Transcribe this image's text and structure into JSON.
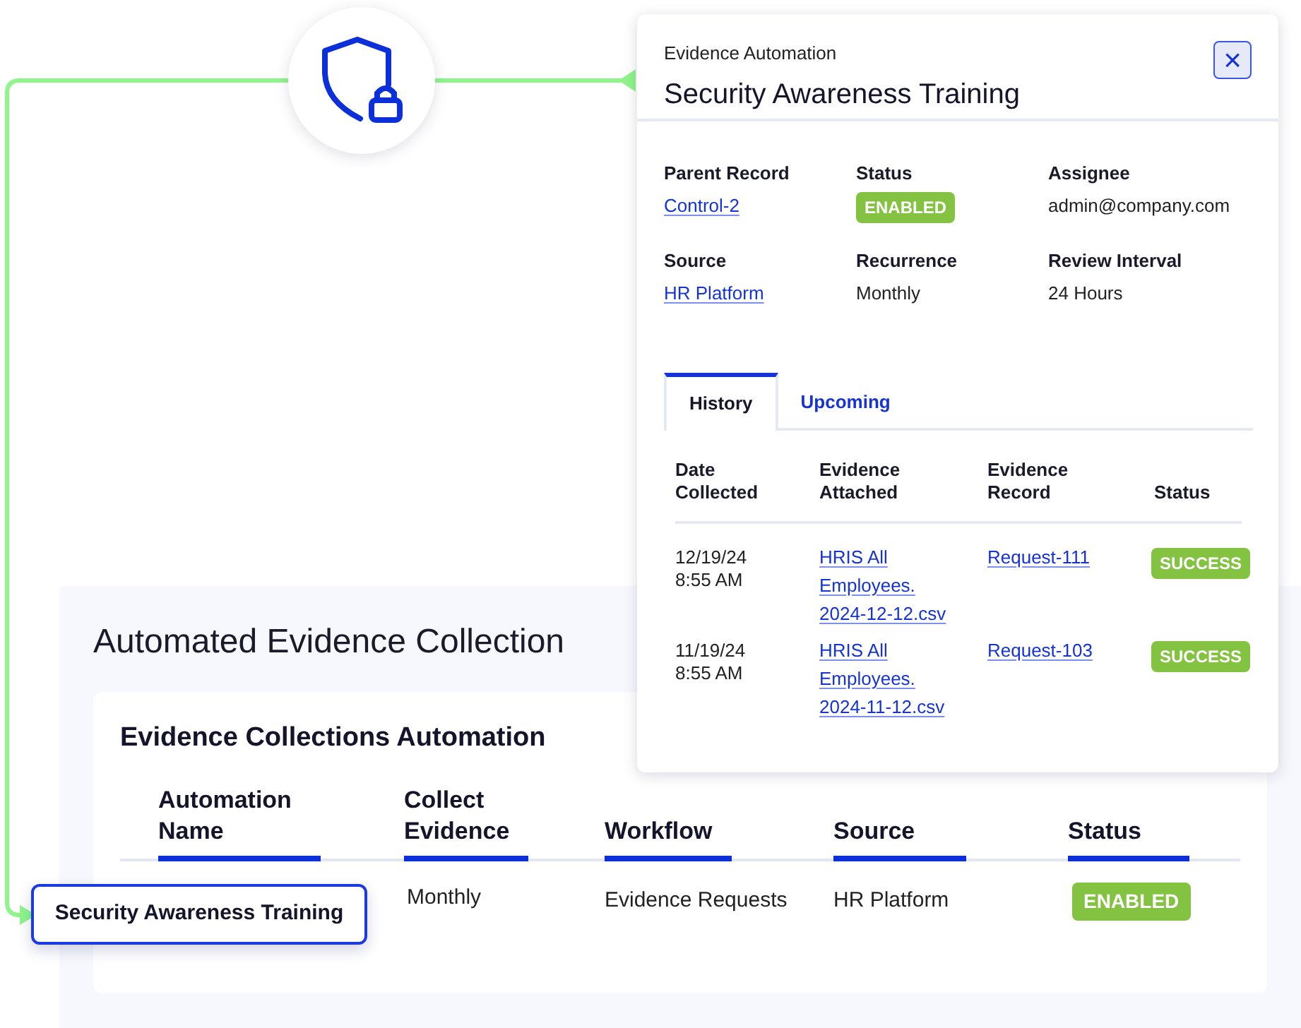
{
  "collection": {
    "title": "Automated Evidence Collection",
    "card_title": "Evidence Collections Automation",
    "columns": [
      "Automation Name",
      "Collect Evidence",
      "Workflow",
      "Source",
      "Status"
    ],
    "rows": [
      {
        "name": "Security Awareness Training",
        "collect": "Monthly",
        "workflow": "Evidence Requests",
        "source": "HR Platform",
        "status": "ENABLED",
        "highlighted": true
      }
    ]
  },
  "detail": {
    "subtitle": "Evidence Automation",
    "title": "Security Awareness Training",
    "close": "×",
    "fields": [
      {
        "label": "Parent Record",
        "value": "Control-2",
        "kind": "link"
      },
      {
        "label": "Status",
        "value": "ENABLED",
        "kind": "badge"
      },
      {
        "label": "Assignee",
        "value": "admin@company.com",
        "kind": "text"
      },
      {
        "label": "Source",
        "value": "HR Platform",
        "kind": "link"
      },
      {
        "label": "Recurrence",
        "value": "Monthly",
        "kind": "text"
      },
      {
        "label": "Review Interval",
        "value": "24 Hours",
        "kind": "text"
      }
    ],
    "tabs": [
      {
        "label": "History",
        "selected": true
      },
      {
        "label": "Upcoming",
        "selected": false
      }
    ],
    "history": {
      "columns": [
        "Date Collected",
        "Evidence Attached",
        "Evidence Record",
        "Status"
      ],
      "rows": [
        {
          "date": "12/19/24 8:55 AM",
          "file": "HRIS All Employees. 2024-12-12.csv",
          "record": "Request-111",
          "status": "SUCCESS"
        },
        {
          "date": "11/19/24 8:55 AM",
          "file": "HRIS All Employees. 2024-11-12.csv",
          "record": "Request-103",
          "status": "SUCCESS"
        }
      ]
    }
  }
}
